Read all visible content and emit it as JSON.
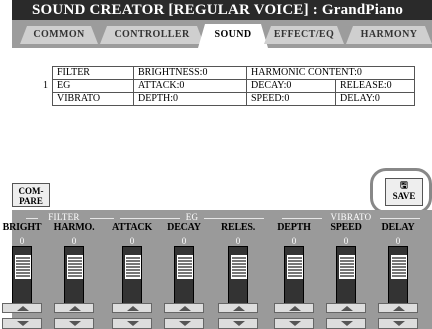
{
  "title": "SOUND CREATOR [REGULAR VOICE] : GrandPiano",
  "tabs": [
    {
      "label": "COMMON",
      "active": false
    },
    {
      "label": "CONTROLLER",
      "active": false
    },
    {
      "label": "SOUND",
      "active": true
    },
    {
      "label": "EFFECT/EQ",
      "active": false
    },
    {
      "label": "HARMONY",
      "active": false
    }
  ],
  "params_table": {
    "row_number": "1",
    "rows": [
      [
        "FILTER",
        "BRIGHTNESS:0",
        "HARMONIC CONTENT:0",
        ""
      ],
      [
        "EG",
        "ATTACK:0",
        "DECAY:0",
        "RELEASE:0"
      ],
      [
        "VIBRATO",
        "DEPTH:0",
        "SPEED:0",
        "DELAY:0"
      ]
    ]
  },
  "compare_button": {
    "line1": "COM-",
    "line2": "PARE"
  },
  "save_button": {
    "icon": "floppy-disk-icon",
    "label": "SAVE"
  },
  "groups": [
    {
      "name": "FILTER",
      "knobs": [
        {
          "label": "BRIGHT",
          "value": "0"
        },
        {
          "label": "HARMO.",
          "value": "0"
        }
      ]
    },
    {
      "name": "EG",
      "knobs": [
        {
          "label": "ATTACK",
          "value": "0"
        },
        {
          "label": "DECAY",
          "value": "0"
        },
        {
          "label": "RELES.",
          "value": "0"
        }
      ]
    },
    {
      "name": "VIBRATO",
      "knobs": [
        {
          "label": "DEPTH",
          "value": "0"
        },
        {
          "label": "SPEED",
          "value": "0"
        },
        {
          "label": "DELAY",
          "value": "0"
        }
      ]
    }
  ],
  "colors": {
    "title_bg": "#2a2a2a",
    "tab_bar_bg": "#9c9c9c",
    "controls_bg": "#9a9a9a",
    "highlight_ring": "#888888"
  }
}
